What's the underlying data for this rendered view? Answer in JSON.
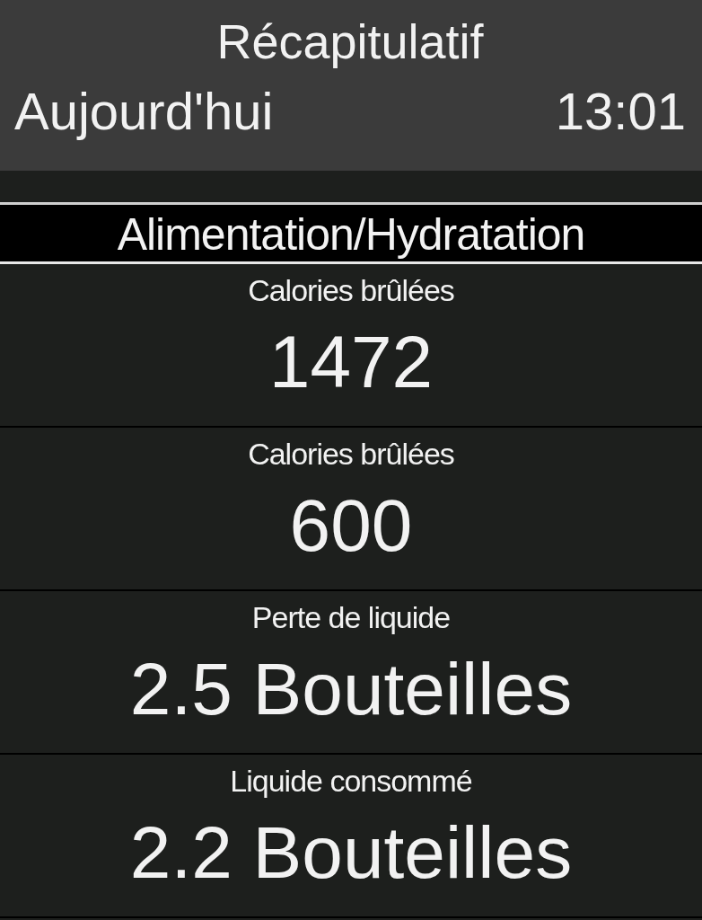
{
  "header": {
    "title": "Récapitulatif",
    "period": "Aujourd'hui",
    "time": "13:01"
  },
  "section": {
    "title": "Alimentation/Hydratation"
  },
  "fields": [
    {
      "label": "Calories brûlées",
      "value": "1472"
    },
    {
      "label": "Calories brûlées",
      "value": "600"
    },
    {
      "label": "Perte de liquide",
      "value": "2.5 Bouteilles"
    },
    {
      "label": "Liquide consommé",
      "value": "2.2 Bouteilles"
    }
  ]
}
